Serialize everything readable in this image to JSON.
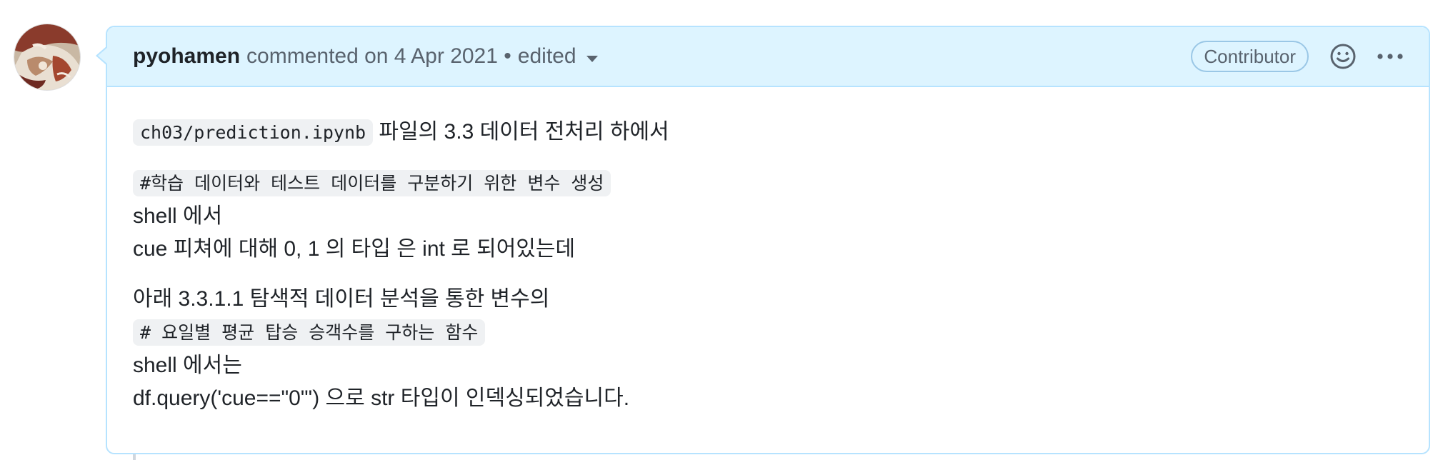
{
  "comment": {
    "author": "pyohamen",
    "meta": "commented on 4 Apr 2021 •",
    "edited": "edited",
    "badge": "Contributor",
    "icons": {
      "reaction": "smiley-icon",
      "more": "kebab-horizontal-icon",
      "dropdown": "triangle-down-icon"
    },
    "body": {
      "p1_code": "ch03/prediction.ipynb",
      "p1_text": " 파일의 3.3 데이터 전처리 하에서",
      "p2_code": "#학습 데이터와 테스트 데이터를 구분하기 위한 변수 생성",
      "p2_line2": "shell 에서",
      "p2_line3": "cue 피쳐에 대해 0, 1 의 타입 은 int 로 되어있는데",
      "p3_line1": "아래 3.3.1.1 탐색적 데이터 분석을 통한 변수의",
      "p3_code": "# 요일별 평균 탑승 승객수를 구하는 함수",
      "p3_line3": "shell 에서는",
      "p3_line4": "df.query('cue==\"0\"') 으로 str 타입이 인덱싱되었습니다."
    }
  },
  "colors": {
    "header_bg": "#ddf4ff",
    "border": "#b6e3ff",
    "muted_text": "#59636e",
    "code_bg": "#eff1f3"
  }
}
